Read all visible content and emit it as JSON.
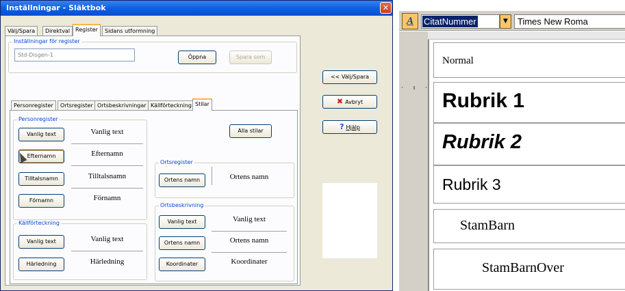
{
  "dialog": {
    "title": "Inställningar - Släktbok",
    "close_icon": "close-icon",
    "tabs": [
      "Välj/Spara",
      "Direktval",
      "Register",
      "Sidans utformning"
    ],
    "active_tab": "Register",
    "settings_group": {
      "label": "Inställningar för register",
      "name_value": "Std-Disgen-1",
      "open_button": "Öppna",
      "save_as_button": "Spara som"
    },
    "subtabs": [
      "Personregister",
      "Ortsregister",
      "Ortsbeskrivningar",
      "Källförteckning",
      "Stilar"
    ],
    "active_subtab": "Stilar",
    "personregister": {
      "label": "Personregister",
      "rows": [
        {
          "button": "Vanlig text",
          "preview": "Vanlig text"
        },
        {
          "button": "Efternamn",
          "preview": "Efternamn"
        },
        {
          "button": "Tilltalsnamn",
          "preview": "Tilltalsnamn"
        },
        {
          "button": "Förnamn",
          "preview": "Förnamn"
        }
      ]
    },
    "kallforteckning": {
      "label": "Källförteckning",
      "rows": [
        {
          "button": "Vanlig text",
          "preview": "Vanlig text"
        },
        {
          "button": "Härledning",
          "preview": "Härledning"
        }
      ]
    },
    "all_styles_button": "Alla stilar",
    "ortsregister": {
      "label": "Ortsregister",
      "rows": [
        {
          "button": "Ortens namn",
          "preview": "Ortens namn"
        }
      ]
    },
    "ortsbeskrivning": {
      "label": "Ortsbeskrivning",
      "rows": [
        {
          "button": "Vanlig text",
          "preview": "Vanlig text"
        },
        {
          "button": "Ortens namn",
          "preview": "Ortens namn"
        },
        {
          "button": "Koordinater",
          "preview": "Koordinater"
        }
      ]
    },
    "side_buttons": {
      "back": "<< Välj/Spara",
      "cancel": "Avbryt",
      "help": "Hjälp"
    },
    "colors": {
      "title_bar": "#0a5ee0",
      "group_label": "#0046d5",
      "tab_highlight": "#f7b64a"
    }
  },
  "word": {
    "styles_icon": "styles-pane-icon",
    "style_box_value": "CitatNummer",
    "font_box_value": "Times New Roma",
    "ruler_marks": "· ı ·",
    "styles": [
      {
        "name": "Normal"
      },
      {
        "name": "Rubrik 1"
      },
      {
        "name": "Rubrik 2"
      },
      {
        "name": "Rubrik 3"
      },
      {
        "name": "StamBarn"
      },
      {
        "name": "StamBarnOver"
      }
    ],
    "colors": {
      "selection": "#0a246a",
      "toolbar": "#d4d0c8",
      "icon_accent": "#f8c56a"
    }
  }
}
